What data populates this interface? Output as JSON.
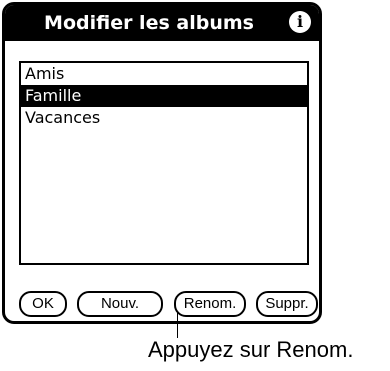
{
  "dialog": {
    "title": "Modifier les albums",
    "info_icon": "info-icon"
  },
  "list": {
    "items": [
      {
        "label": "Amis",
        "selected": false
      },
      {
        "label": "Famille",
        "selected": true
      },
      {
        "label": "Vacances",
        "selected": false
      }
    ]
  },
  "buttons": {
    "ok": "OK",
    "new": "Nouv.",
    "rename": "Renom.",
    "delete": "Suppr."
  },
  "callout": {
    "text": "Appuyez sur Renom."
  }
}
